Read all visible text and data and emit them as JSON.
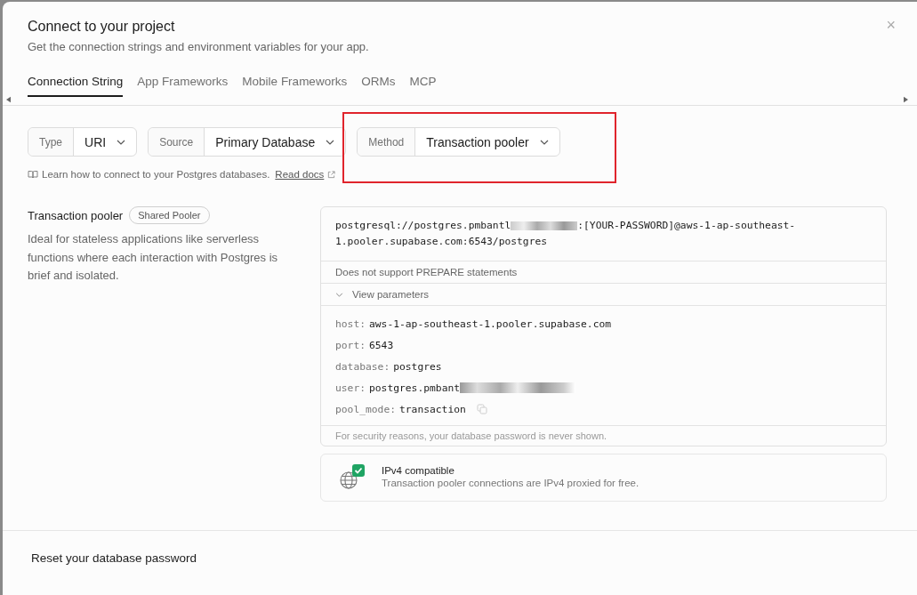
{
  "dialog": {
    "title": "Connect to your project",
    "subtitle": "Get the connection strings and environment variables for your app.",
    "close": "×"
  },
  "tabs": [
    {
      "label": "Connection String",
      "selected": true
    },
    {
      "label": "App Frameworks",
      "selected": false
    },
    {
      "label": "Mobile Frameworks",
      "selected": false
    },
    {
      "label": "ORMs",
      "selected": false
    },
    {
      "label": "MCP",
      "selected": false
    }
  ],
  "selectors": [
    {
      "label": "Type",
      "value": "URI",
      "highlighted": false
    },
    {
      "label": "Source",
      "value": "Primary Database",
      "highlighted": false
    },
    {
      "label": "Method",
      "value": "Transaction pooler",
      "highlighted": true
    }
  ],
  "docs_hint": {
    "text": "Learn how to connect to your Postgres databases.",
    "link": "Read docs"
  },
  "pooler": {
    "title": "Transaction pooler",
    "badge": "Shared Pooler",
    "description": "Ideal for stateless applications like serverless functions where each interaction with Postgres is brief and isolated."
  },
  "connection": {
    "uri_start": "postgresql://postgres.pmbantl",
    "uri_line_1": ":[YOUR-PASSWORD]@aws-1-ap-southeast-",
    "uri_line_2": "1.pooler.supabase.com:6543/postgres",
    "note": "Does not support PREPARE statements",
    "toggle": "View parameters",
    "expanded": true,
    "params": [
      {
        "key": "host:",
        "value": "aws-1-ap-southeast-1.pooler.supabase.com",
        "redacted": false,
        "copy": false
      },
      {
        "key": "port:",
        "value": "6543",
        "redacted": false,
        "copy": false
      },
      {
        "key": "database:",
        "value": "postgres",
        "redacted": false,
        "copy": false
      },
      {
        "key": "user:",
        "value": "postgres.pmbant",
        "redacted": true,
        "copy": false
      },
      {
        "key": "pool_mode:",
        "value": "transaction",
        "redacted": false,
        "copy": true
      }
    ],
    "footer": "For security reasons, your database password is never shown."
  },
  "ipv4": {
    "title": "IPv4 compatible",
    "text": "Transaction pooler connections are IPv4 proxied for free.",
    "compatible": true
  },
  "reset": {
    "title": "Reset your database password"
  }
}
